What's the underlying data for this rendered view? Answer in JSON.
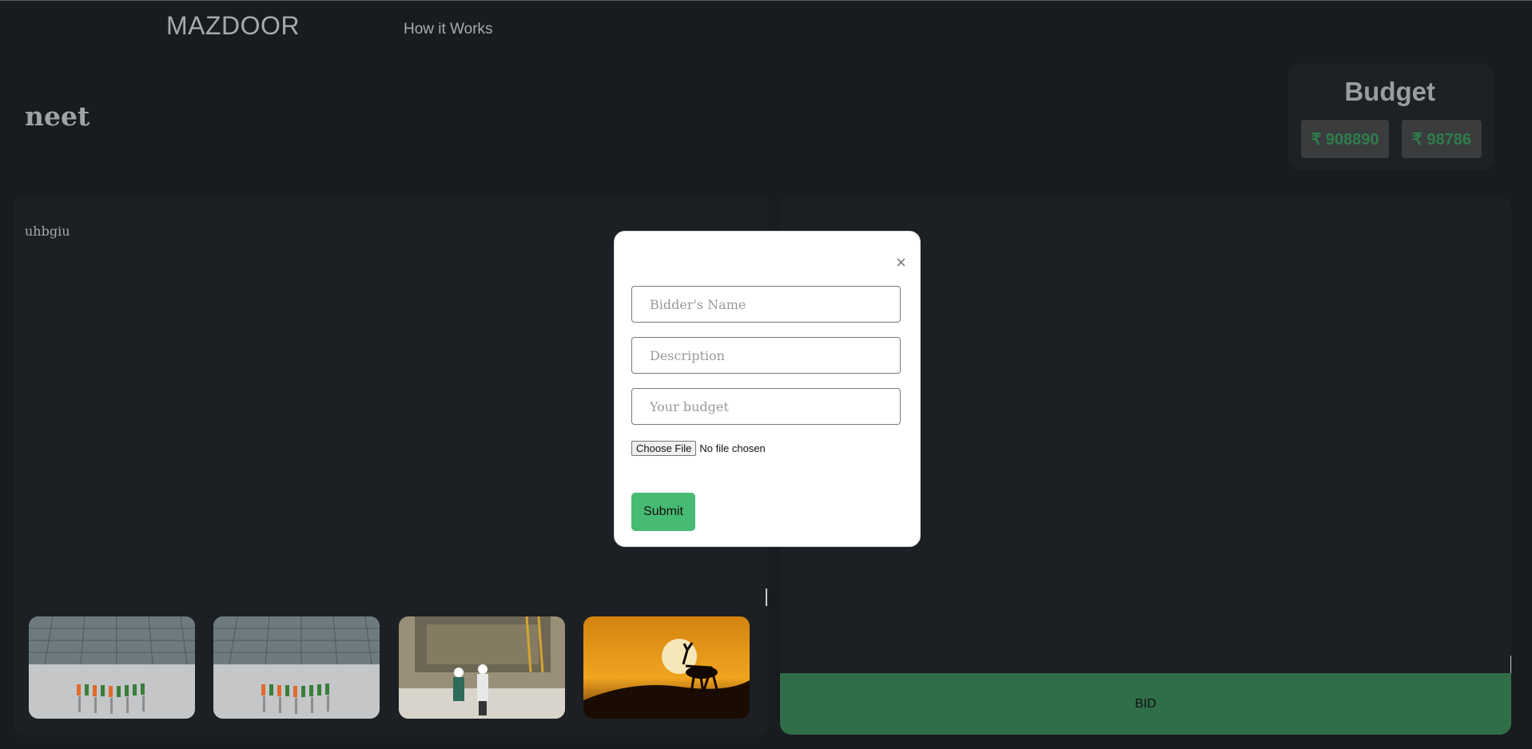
{
  "header": {
    "brand": "MAZDOOR",
    "nav_link": "How it Works"
  },
  "job": {
    "title": "neet",
    "description": "uhbgiu"
  },
  "budget": {
    "title": "Budget",
    "min": "₹ 908890",
    "max": "₹ 98786"
  },
  "bid_button": "BID",
  "modal": {
    "close": "×",
    "name_placeholder": "Bidder's Name",
    "description_placeholder": "Description",
    "budget_placeholder": "Your budget",
    "choose_file": "Choose File",
    "no_file": "No file chosen",
    "submit": "Submit"
  },
  "colors": {
    "background": "#181b1f",
    "panel": "#1c1f23",
    "bid_green": "#2f6e47",
    "submit_green": "#47bb73",
    "budget_value": "#2e7d4a"
  }
}
